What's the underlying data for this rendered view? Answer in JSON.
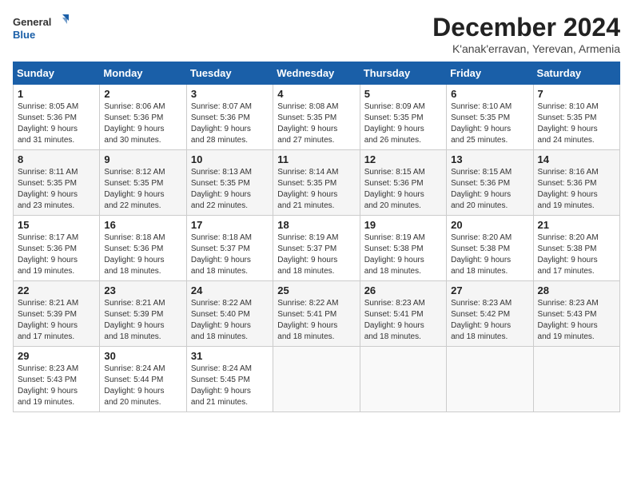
{
  "logo": {
    "line1": "General",
    "line2": "Blue"
  },
  "title": "December 2024",
  "subtitle": "K'anak'erravan, Yerevan, Armenia",
  "days_of_week": [
    "Sunday",
    "Monday",
    "Tuesday",
    "Wednesday",
    "Thursday",
    "Friday",
    "Saturday"
  ],
  "weeks": [
    [
      {
        "day": "1",
        "sunrise": "8:05 AM",
        "sunset": "5:36 PM",
        "daylight": "9 hours and 31 minutes."
      },
      {
        "day": "2",
        "sunrise": "8:06 AM",
        "sunset": "5:36 PM",
        "daylight": "9 hours and 30 minutes."
      },
      {
        "day": "3",
        "sunrise": "8:07 AM",
        "sunset": "5:36 PM",
        "daylight": "9 hours and 28 minutes."
      },
      {
        "day": "4",
        "sunrise": "8:08 AM",
        "sunset": "5:35 PM",
        "daylight": "9 hours and 27 minutes."
      },
      {
        "day": "5",
        "sunrise": "8:09 AM",
        "sunset": "5:35 PM",
        "daylight": "9 hours and 26 minutes."
      },
      {
        "day": "6",
        "sunrise": "8:10 AM",
        "sunset": "5:35 PM",
        "daylight": "9 hours and 25 minutes."
      },
      {
        "day": "7",
        "sunrise": "8:10 AM",
        "sunset": "5:35 PM",
        "daylight": "9 hours and 24 minutes."
      }
    ],
    [
      {
        "day": "8",
        "sunrise": "8:11 AM",
        "sunset": "5:35 PM",
        "daylight": "9 hours and 23 minutes."
      },
      {
        "day": "9",
        "sunrise": "8:12 AM",
        "sunset": "5:35 PM",
        "daylight": "9 hours and 22 minutes."
      },
      {
        "day": "10",
        "sunrise": "8:13 AM",
        "sunset": "5:35 PM",
        "daylight": "9 hours and 22 minutes."
      },
      {
        "day": "11",
        "sunrise": "8:14 AM",
        "sunset": "5:35 PM",
        "daylight": "9 hours and 21 minutes."
      },
      {
        "day": "12",
        "sunrise": "8:15 AM",
        "sunset": "5:36 PM",
        "daylight": "9 hours and 20 minutes."
      },
      {
        "day": "13",
        "sunrise": "8:15 AM",
        "sunset": "5:36 PM",
        "daylight": "9 hours and 20 minutes."
      },
      {
        "day": "14",
        "sunrise": "8:16 AM",
        "sunset": "5:36 PM",
        "daylight": "9 hours and 19 minutes."
      }
    ],
    [
      {
        "day": "15",
        "sunrise": "8:17 AM",
        "sunset": "5:36 PM",
        "daylight": "9 hours and 19 minutes."
      },
      {
        "day": "16",
        "sunrise": "8:18 AM",
        "sunset": "5:36 PM",
        "daylight": "9 hours and 18 minutes."
      },
      {
        "day": "17",
        "sunrise": "8:18 AM",
        "sunset": "5:37 PM",
        "daylight": "9 hours and 18 minutes."
      },
      {
        "day": "18",
        "sunrise": "8:19 AM",
        "sunset": "5:37 PM",
        "daylight": "9 hours and 18 minutes."
      },
      {
        "day": "19",
        "sunrise": "8:19 AM",
        "sunset": "5:38 PM",
        "daylight": "9 hours and 18 minutes."
      },
      {
        "day": "20",
        "sunrise": "8:20 AM",
        "sunset": "5:38 PM",
        "daylight": "9 hours and 18 minutes."
      },
      {
        "day": "21",
        "sunrise": "8:20 AM",
        "sunset": "5:38 PM",
        "daylight": "9 hours and 17 minutes."
      }
    ],
    [
      {
        "day": "22",
        "sunrise": "8:21 AM",
        "sunset": "5:39 PM",
        "daylight": "9 hours and 17 minutes."
      },
      {
        "day": "23",
        "sunrise": "8:21 AM",
        "sunset": "5:39 PM",
        "daylight": "9 hours and 18 minutes."
      },
      {
        "day": "24",
        "sunrise": "8:22 AM",
        "sunset": "5:40 PM",
        "daylight": "9 hours and 18 minutes."
      },
      {
        "day": "25",
        "sunrise": "8:22 AM",
        "sunset": "5:41 PM",
        "daylight": "9 hours and 18 minutes."
      },
      {
        "day": "26",
        "sunrise": "8:23 AM",
        "sunset": "5:41 PM",
        "daylight": "9 hours and 18 minutes."
      },
      {
        "day": "27",
        "sunrise": "8:23 AM",
        "sunset": "5:42 PM",
        "daylight": "9 hours and 18 minutes."
      },
      {
        "day": "28",
        "sunrise": "8:23 AM",
        "sunset": "5:43 PM",
        "daylight": "9 hours and 19 minutes."
      }
    ],
    [
      {
        "day": "29",
        "sunrise": "8:23 AM",
        "sunset": "5:43 PM",
        "daylight": "9 hours and 19 minutes."
      },
      {
        "day": "30",
        "sunrise": "8:24 AM",
        "sunset": "5:44 PM",
        "daylight": "9 hours and 20 minutes."
      },
      {
        "day": "31",
        "sunrise": "8:24 AM",
        "sunset": "5:45 PM",
        "daylight": "9 hours and 21 minutes."
      },
      null,
      null,
      null,
      null
    ]
  ],
  "labels": {
    "sunrise": "Sunrise:",
    "sunset": "Sunset:",
    "daylight": "Daylight:"
  }
}
